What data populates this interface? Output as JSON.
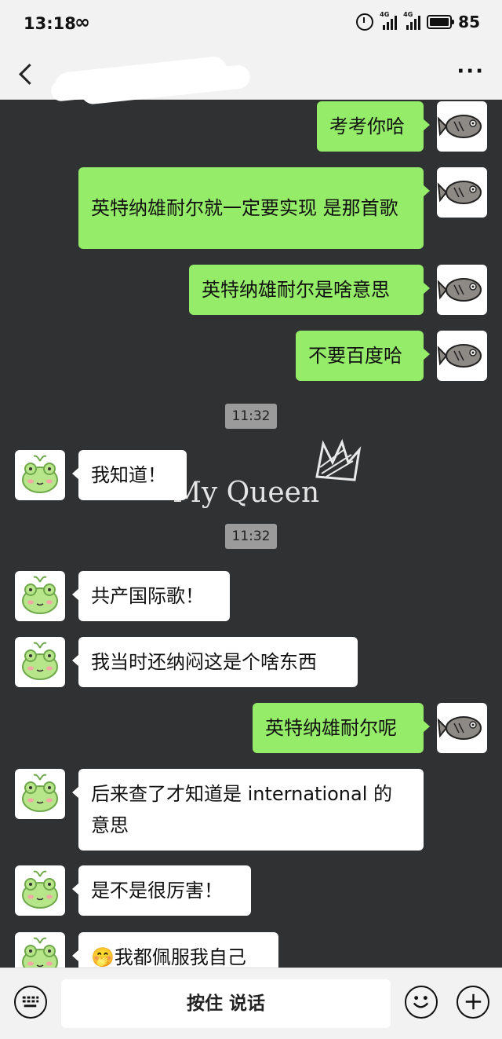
{
  "status_bar": {
    "time": "13:18",
    "loop_symbol": "∞",
    "signal_badge": "4G",
    "battery": "85"
  },
  "header": {
    "back_icon": "chevron-left-icon",
    "more_label": "···"
  },
  "chat": {
    "timestamp1": "11:32",
    "timestamp2": "11:32",
    "watermark": "My Queen",
    "messages": [
      {
        "side": "me",
        "text": "考考你哈"
      },
      {
        "side": "me",
        "text": "英特纳雄耐尔就一定要实现 是那首歌"
      },
      {
        "side": "me",
        "text": "英特纳雄耐尔是啥意思"
      },
      {
        "side": "me",
        "text": "不要百度哈"
      },
      {
        "side": "them",
        "text": "我知道！"
      },
      {
        "side": "them",
        "text": "共产国际歌！"
      },
      {
        "side": "them",
        "text": "我当时还纳闷这是个啥东西"
      },
      {
        "side": "me",
        "text": "英特纳雄耐尔呢"
      },
      {
        "side": "them",
        "text": "后来查了才知道是 international 的意思"
      },
      {
        "side": "them",
        "text": "是不是很厉害！"
      },
      {
        "side": "them",
        "emoji": "🤭",
        "text": "我都佩服我自己"
      }
    ]
  },
  "input_bar": {
    "voice_label": "按住 说话",
    "keyboard_icon": "keyboard-icon",
    "emoji_icon": "smiley-icon",
    "plus_icon": "plus-icon"
  },
  "colors": {
    "my_bubble": "#95ec69",
    "their_bubble": "#ffffff",
    "chat_background": "#2f3133",
    "bar_background": "#f2f2f2"
  }
}
